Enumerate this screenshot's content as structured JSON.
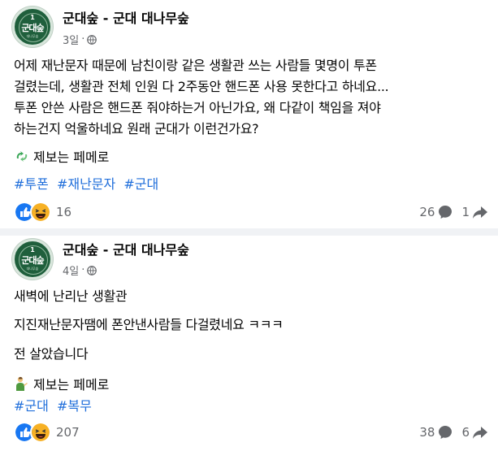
{
  "posts": [
    {
      "avatar_text": {
        "num": "1",
        "name": "군대숲",
        "sub": "대나무숲"
      },
      "page_name": "군대숲 - 군대 대나무숲",
      "time": "3일",
      "body_lines": [
        "어제 재난문자 때문에 남친이랑 같은 생활관 쓰는 사람들 몇명이 투폰",
        "걸렸는데, 생활관 전체 인원 다 2주동안 핸드폰 사용 못한다고 하네요...",
        "투폰 안쓴 사람은 핸드폰 줘야하는거 아닌가요, 왜 다같이 책임을 져야",
        "하는건지 억울하네요 원래 군대가 이런건가요?"
      ],
      "tip": "제보는 페메로",
      "hashtags": [
        "#투폰",
        "#재난문자",
        "#군대"
      ],
      "reactions_count": "16",
      "comments_count": "26",
      "shares_count": "1"
    },
    {
      "avatar_text": {
        "num": "1",
        "name": "군대숲",
        "sub": "대나무숲"
      },
      "page_name": "군대숲 - 군대 대나무숲",
      "time": "4일",
      "body_lines": [
        "새벽에 난리난 생활관",
        "지진재난문자땜에 폰안낸사람들 다걸렸네요 ㅋㅋㅋ",
        "전 살았습니다"
      ],
      "tip": "제보는 페메로",
      "hashtags": [
        "#군대",
        "#복무"
      ],
      "reactions_count": "207",
      "comments_count": "38",
      "shares_count": "6"
    }
  ],
  "colors": {
    "hashtag": "#216fdb",
    "like": "#1877f2",
    "haha": "#f7b125",
    "secondary": "#65676b"
  }
}
